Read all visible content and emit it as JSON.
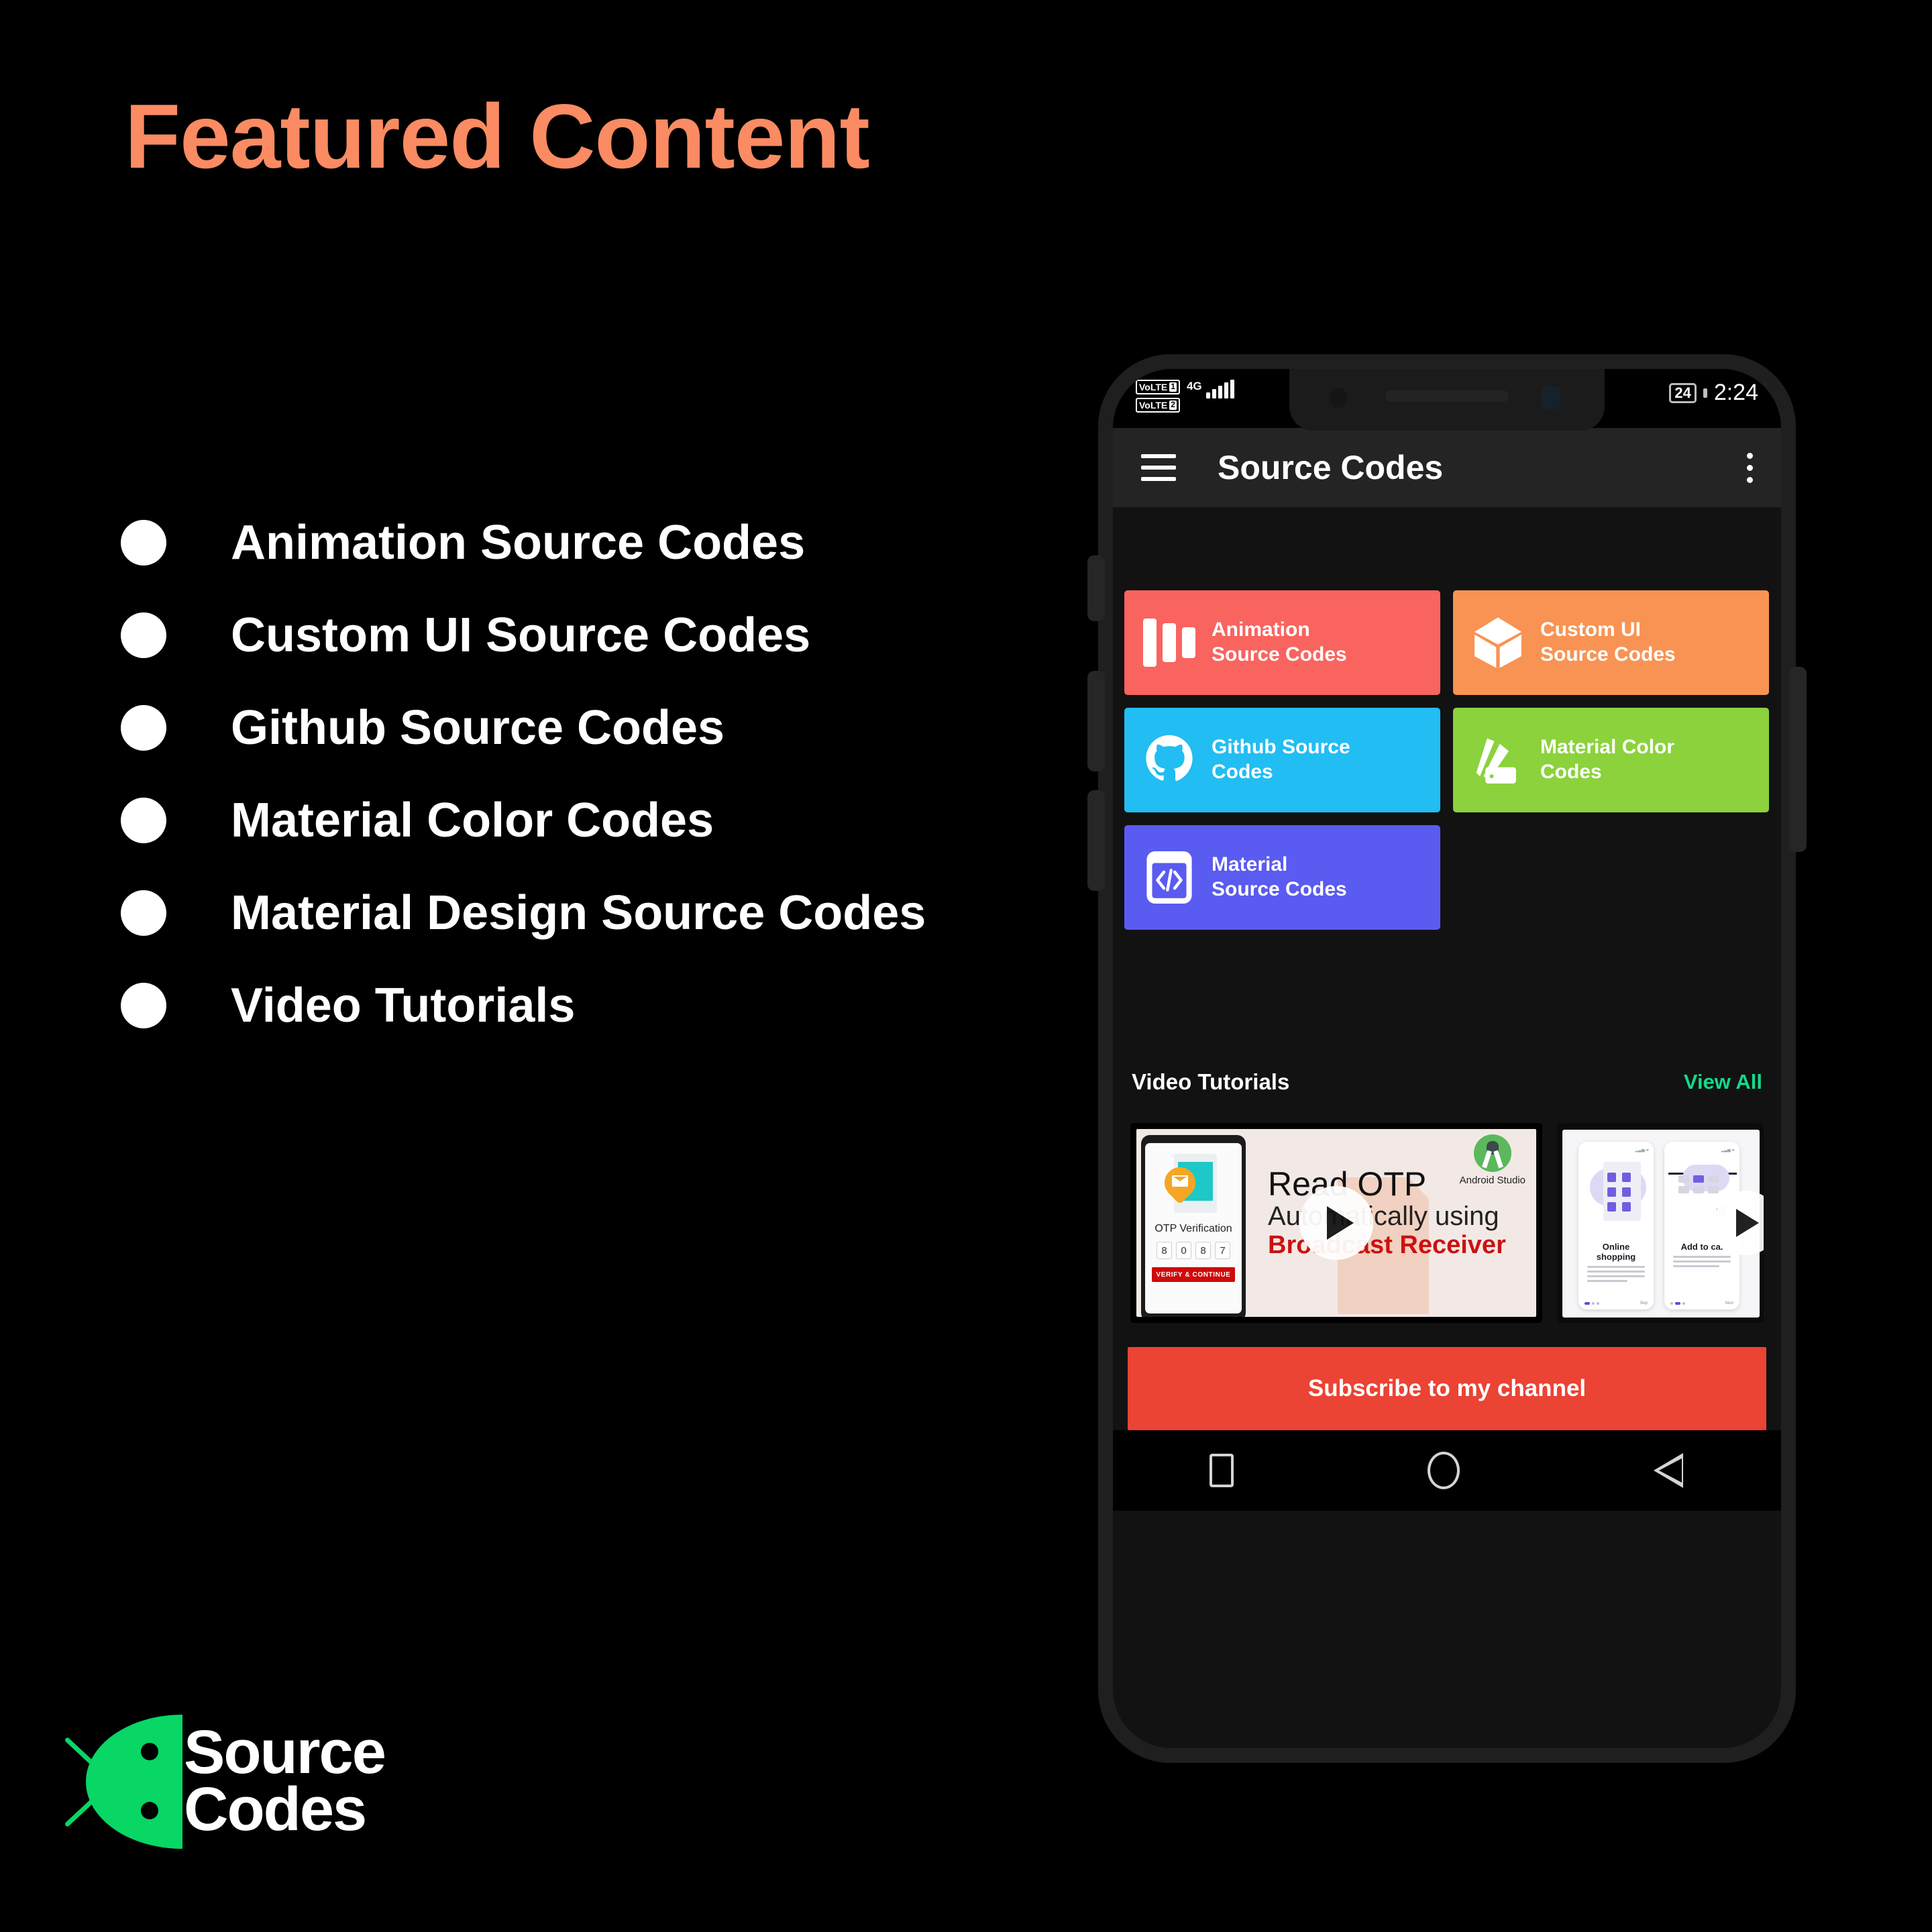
{
  "slide": {
    "title": "Featured Content",
    "title_color": "#FA8B62",
    "background": "#000000"
  },
  "features": [
    {
      "label": "Animation Source Codes"
    },
    {
      "label": "Custom UI Source Codes"
    },
    {
      "label": "Github Source Codes"
    },
    {
      "label": "Material Color Codes"
    },
    {
      "label": "Material Design Source Codes"
    },
    {
      "label": "Video Tutorials"
    }
  ],
  "brand": {
    "line1_white": "Sour",
    "line1_accent": "c",
    "line1_rest": "e",
    "line1": "Source",
    "line2": "Codes",
    "accent_color": "#08D665"
  },
  "phone": {
    "status_bar": {
      "volte1": "VoLTE",
      "sim1": "1",
      "volte2": "VoLTE",
      "sim2": "2",
      "network": "4G",
      "battery": "24",
      "time": "2:24"
    },
    "app_bar": {
      "title": "Source Codes",
      "menu_icon": "hamburger-menu-icon",
      "overflow_icon": "kebab-menu-icon"
    },
    "tiles": [
      {
        "line1": "Animation",
        "line2": "Source Codes",
        "color": "#F9645F",
        "icon": "animation-bars-icon"
      },
      {
        "line1": "Custom UI",
        "line2": "Source Codes",
        "color": "#F89353",
        "icon": "cube-icon"
      },
      {
        "line1": "Github Source",
        "line2": "Codes",
        "color": "#22BDF2",
        "icon": "github-icon"
      },
      {
        "line1": "Material Color",
        "line2": "Codes",
        "color": "#8BD23C",
        "icon": "color-swatch-icon"
      },
      {
        "line1": "Material",
        "line2": "Source Codes",
        "color": "#5A5BF0",
        "icon": "code-phone-icon"
      }
    ],
    "video_section": {
      "title": "Video Tutorials",
      "view_all": "View All",
      "view_all_color": "#14D98A",
      "thumbnails": [
        {
          "title_line1": "Read OTP",
          "title_line2": "Automatically using",
          "title_line3": "Broadcast Receiver",
          "badge": "Android Studio",
          "phone_caption": "OTP Verification",
          "otp_digits": [
            "8",
            "0",
            "8",
            "7"
          ],
          "phone_button": "VERIFY & CONTINUE",
          "play_icon": "play-icon"
        },
        {
          "screen1_title": "Online shopping",
          "screen2_title": "Add to ca.",
          "screen1_skip": "Skip",
          "screen2_skip": "Next",
          "play_icon": "play-icon"
        }
      ]
    },
    "subscribe_button": "Subscribe to my channel",
    "subscribe_color": "#EB4334",
    "nav_bar": {
      "recents": "recents-square-icon",
      "home": "home-circle-icon",
      "back": "back-triangle-icon"
    }
  }
}
